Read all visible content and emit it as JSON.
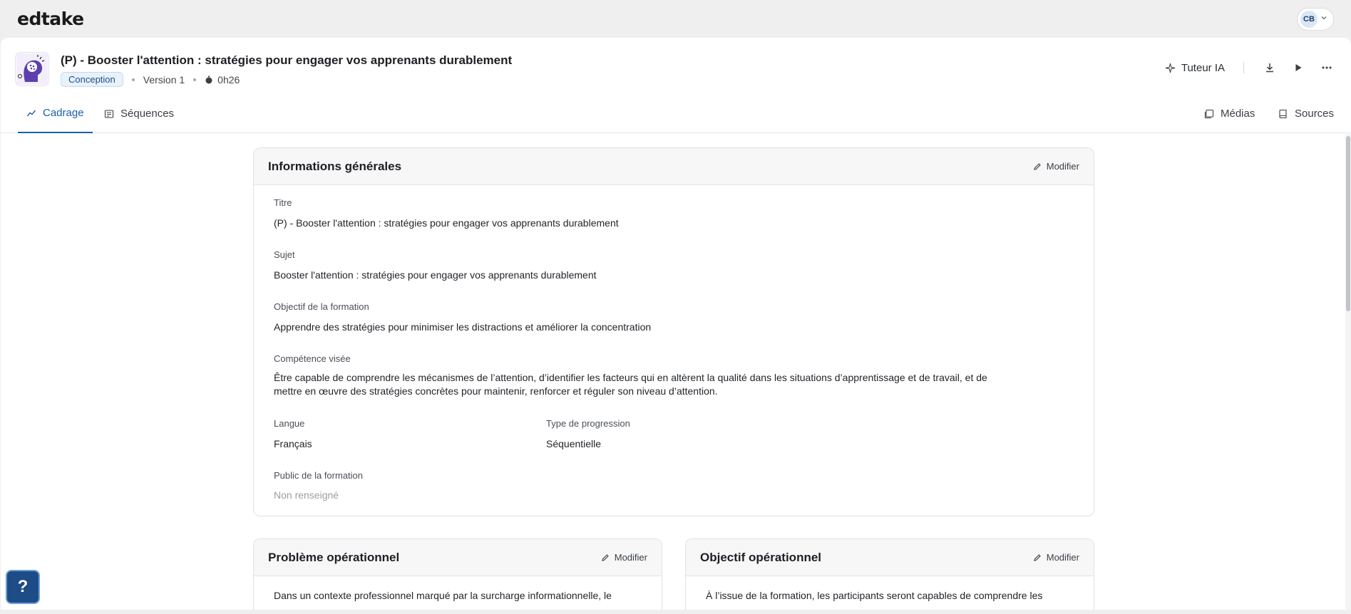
{
  "app": {
    "logo": "edtake"
  },
  "user": {
    "initials": "CB"
  },
  "course": {
    "title": "(P) - Booster l'attention : stratégies pour engager vos apprenants durablement",
    "status": "Conception",
    "version": "Version 1",
    "duration": "0h26"
  },
  "header_actions": {
    "ai_tutor": "Tuteur IA"
  },
  "tabs": {
    "cadrage": "Cadrage",
    "sequences": "Séquences",
    "medias": "Médias",
    "sources": "Sources"
  },
  "general_info": {
    "title": "Informations générales",
    "edit_label": "Modifier",
    "fields": {
      "titre": {
        "label": "Titre",
        "value": "(P) - Booster l'attention : stratégies pour engager vos apprenants durablement"
      },
      "sujet": {
        "label": "Sujet",
        "value": "Booster l'attention : stratégies pour engager vos apprenants durablement"
      },
      "objectif": {
        "label": "Objectif de la formation",
        "value": "Apprendre des stratégies pour minimiser les distractions et améliorer la concentration"
      },
      "competence": {
        "label": "Compétence visée",
        "value_line1": "Être capable de comprendre les mécanismes de l’attention, d’identifier les facteurs qui en altèrent la qualité dans les situations d’apprentissage et de travail, et de",
        "value_line2": "mettre en œuvre des stratégies concrètes pour maintenir, renforcer et réguler son niveau d’attention."
      },
      "langue": {
        "label": "Langue",
        "value": "Français"
      },
      "progression": {
        "label": "Type de progression",
        "value": "Séquentielle"
      },
      "public": {
        "label": "Public de la formation",
        "value": "Non renseigné"
      }
    }
  },
  "probleme": {
    "title": "Problème opérationnel",
    "edit_label": "Modifier",
    "text": "Dans un contexte professionnel marqué par la surcharge informationnelle, le"
  },
  "objectif_op": {
    "title": "Objectif opérationnel",
    "edit_label": "Modifier",
    "text": "À l’issue de la formation, les participants seront capables de comprendre les"
  },
  "help": {
    "label": "?"
  },
  "colors": {
    "accent": "#1b5fa8",
    "help_bg": "#1d4c86"
  }
}
